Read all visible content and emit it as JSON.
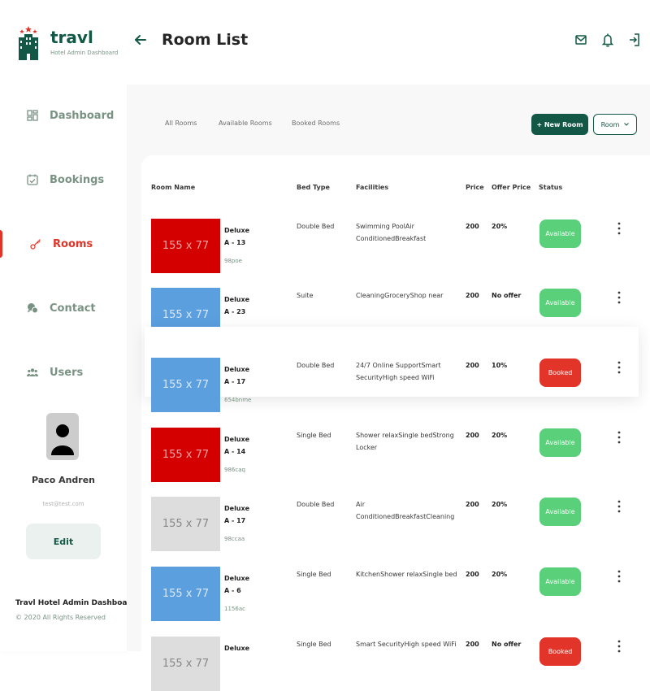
{
  "brand": {
    "title": "travl",
    "subtitle": "Hotel Admin Dashboard"
  },
  "nav": [
    {
      "label": "Dashboard",
      "icon": "dashboard-icon"
    },
    {
      "label": "Bookings",
      "icon": "calendar-icon"
    },
    {
      "label": "Rooms",
      "icon": "key-icon",
      "active": true
    },
    {
      "label": "Contact",
      "icon": "chat-icon"
    },
    {
      "label": "Users",
      "icon": "users-icon"
    }
  ],
  "user": {
    "name": "Paco Andren",
    "email": "test@test.com",
    "edit_label": "Edit"
  },
  "footer": {
    "title": "Travl Hotel Admin Dashboard",
    "copyright": "© 2020 All Rights Reserved"
  },
  "header": {
    "title": "Room List",
    "icons": [
      "mail-icon",
      "bell-icon",
      "logout-icon"
    ]
  },
  "tabs": [
    "All Rooms",
    "Available Rooms",
    "Booked Rooms"
  ],
  "toolbar": {
    "new_room_label": "+ New Room",
    "sort_label": "Room"
  },
  "columns": [
    "Room Name",
    "Bed Type",
    "Facilities",
    "Price",
    "Offer Price",
    "Status"
  ],
  "colors": {
    "brand_green": "#135846",
    "available": "#5AD07A",
    "booked": "#E23428",
    "thumb_red": "#d40000",
    "thumb_blue": "#5b9fdf",
    "thumb_gray": "#dddddd"
  },
  "rooms": [
    {
      "thumb": "155 x 77",
      "thumb_color": "#d40000",
      "thumb_text_color": "#f0a0a0",
      "type": "Deluxe",
      "number": "A - 13",
      "id": "98poe",
      "bed": "Double Bed",
      "facilities": "Swimming PoolAir ConditionedBreakfast",
      "price": "200",
      "offer": "20%",
      "status": "Available"
    },
    {
      "thumb": "155 x 77",
      "thumb_color": "#5b9fdf",
      "thumb_text_color": "#d6e8f8",
      "type": "Deluxe",
      "number": "A - 23",
      "id": "9863mlk",
      "bed": "Suite",
      "facilities": "CleaningGroceryShop near",
      "price": "200",
      "offer": "No offer",
      "status": "Available"
    },
    {
      "thumb": "155 x 77",
      "thumb_color": "#5b9fdf",
      "thumb_text_color": "#d6e8f8",
      "type": "Deluxe",
      "number": "A - 17",
      "id": "654bnme",
      "bed": "Double Bed",
      "facilities": "24/7 Online SupportSmart SecurityHigh speed WiFi",
      "price": "200",
      "offer": "10%",
      "status": "Booked"
    },
    {
      "thumb": "155 x 77",
      "thumb_color": "#d40000",
      "thumb_text_color": "#f0a0a0",
      "type": "Deluxe",
      "number": "A - 14",
      "id": "986caq",
      "bed": "Single Bed",
      "facilities": "Shower relaxSingle bedStrong Locker",
      "price": "200",
      "offer": "20%",
      "status": "Available"
    },
    {
      "thumb": "155 x 77",
      "thumb_color": "#dddddd",
      "thumb_text_color": "#888888",
      "type": "Deluxe",
      "number": "A - 17",
      "id": "98ccaa",
      "bed": "Double Bed",
      "facilities": "Air ConditionedBreakfastCleaning",
      "price": "200",
      "offer": "20%",
      "status": "Available"
    },
    {
      "thumb": "155 x 77",
      "thumb_color": "#5b9fdf",
      "thumb_text_color": "#d6e8f8",
      "type": "Deluxe",
      "number": "A - 6",
      "id": "1156ac",
      "bed": "Single Bed",
      "facilities": "KitchenShower relaxSingle bed",
      "price": "200",
      "offer": "20%",
      "status": "Available"
    },
    {
      "thumb": "155 x 77",
      "thumb_color": "#dddddd",
      "thumb_text_color": "#888888",
      "type": "Deluxe",
      "number": "",
      "id": "",
      "bed": "Single Bed",
      "facilities": "Smart SecurityHigh speed WiFi",
      "price": "200",
      "offer": "No offer",
      "status": "Booked"
    }
  ]
}
